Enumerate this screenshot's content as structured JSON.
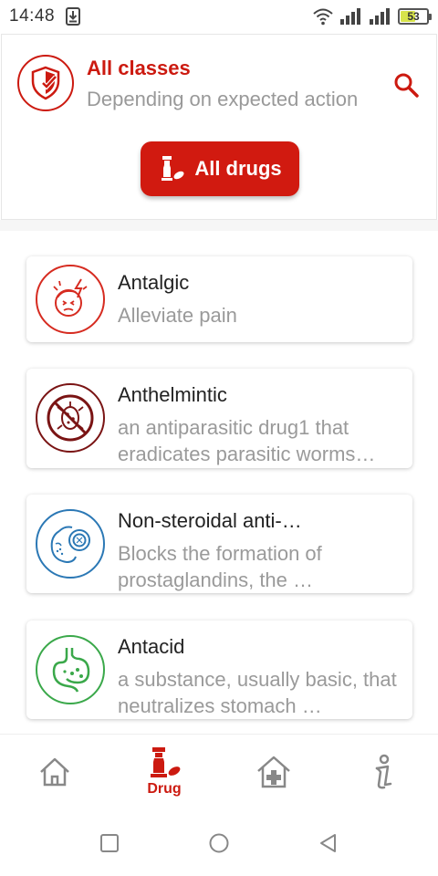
{
  "status_bar": {
    "time": "14:48",
    "battery_level": "53",
    "icons": [
      "download-icon",
      "wifi-icon",
      "signal-icon",
      "signal-icon",
      "battery-icon"
    ]
  },
  "header": {
    "title": "All classes",
    "subtitle": "Depending on expected action",
    "icon": "shield-check-icon",
    "search_icon": "search-icon",
    "button_label": "All drugs",
    "button_icon": "drug-icon"
  },
  "classes": [
    {
      "name": "Antalgic",
      "description": "Alleviate pain",
      "icon": "headache-face-icon",
      "color": "#d62b20"
    },
    {
      "name": "Anthelmintic",
      "description": "an antiparasitic drug1 that eradicates parasitic worms…",
      "icon": "no-parasite-icon",
      "color": "#7a1414"
    },
    {
      "name": "Non-steroidal anti-…",
      "description": "Blocks the formation of prostaglandins, the …",
      "icon": "face-magnifier-icon",
      "color": "#2b78b5"
    },
    {
      "name": "Antacid",
      "description": "a substance, usually basic, that neutralizes stomach …",
      "icon": "stomach-icon",
      "color": "#3aa84a"
    }
  ],
  "bottom_nav": {
    "items": [
      {
        "icon": "home-icon",
        "label": ""
      },
      {
        "icon": "drug-icon",
        "label": "Drug",
        "active": true
      },
      {
        "icon": "hospital-icon",
        "label": ""
      },
      {
        "icon": "info-icon",
        "label": ""
      }
    ]
  },
  "system_nav": [
    "recent-apps-icon",
    "home-circle-icon",
    "back-icon"
  ],
  "colors": {
    "accent": "#cc1a10",
    "muted_text": "#9a9a9a",
    "nav_icon": "#888888"
  }
}
